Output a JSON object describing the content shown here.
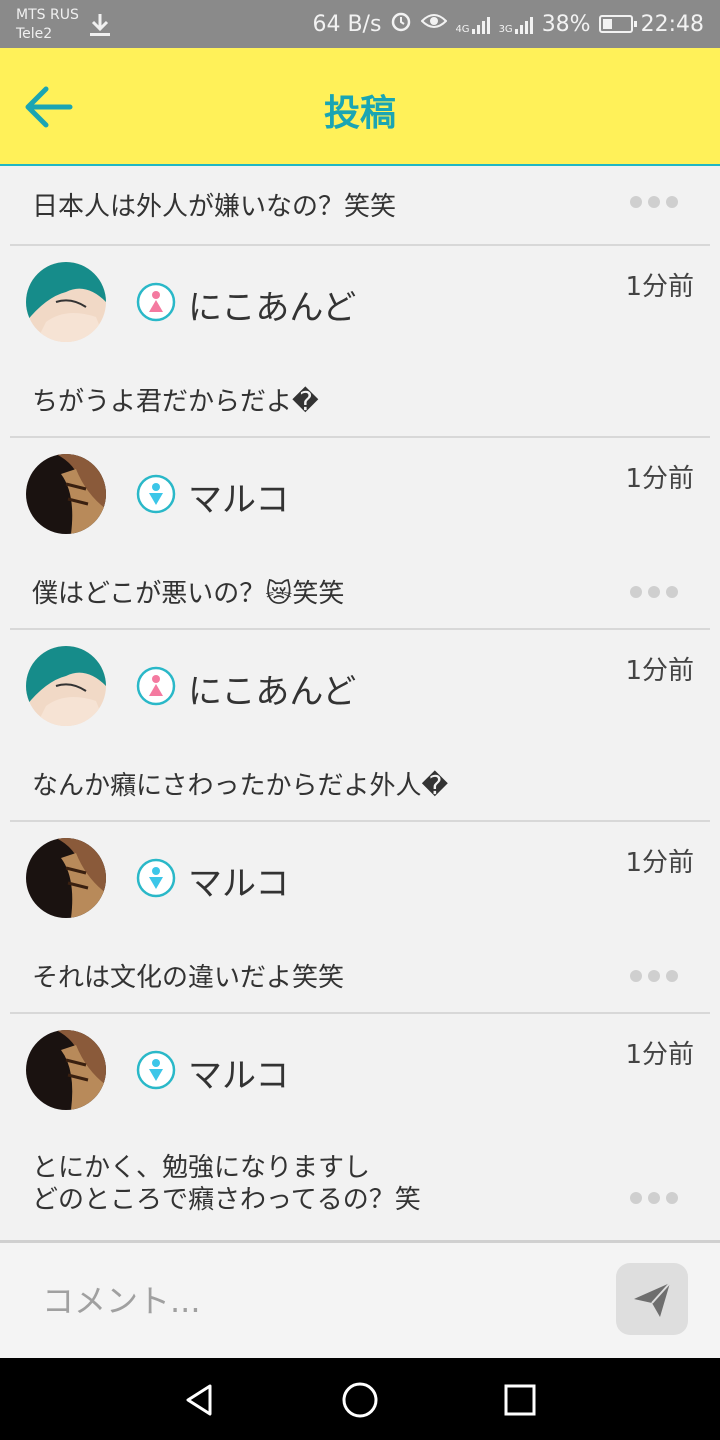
{
  "status_bar": {
    "carrier_primary": "MTS RUS",
    "carrier_secondary": "Tele2",
    "net_speed": "64 B/s",
    "signal_1": "4G",
    "signal_2": "3G",
    "battery_percent": "38%",
    "battery_level": 0.38,
    "time": "22:48",
    "icons": [
      "download-icon",
      "alarm-icon",
      "eye-icon",
      "signal-icon",
      "battery-icon"
    ]
  },
  "header": {
    "title": "投稿",
    "back_icon": "back-arrow-icon",
    "accent_color": "#1aa5b3",
    "background_color": "#fff159"
  },
  "top_post": {
    "text": "日本人は外人が嫌いなの？笑笑"
  },
  "comments": [
    {
      "username": "にこあんど",
      "gender": "female",
      "time": "1分前",
      "text": "ちがうよ君だからだよ�",
      "show_menu": false
    },
    {
      "username": "マルコ",
      "gender": "male",
      "time": "1分前",
      "text": "僕はどこが悪いの？😿笑笑",
      "show_menu": true
    },
    {
      "username": "にこあんど",
      "gender": "female",
      "time": "1分前",
      "text": "なんか癪にさわったからだよ外人�",
      "show_menu": false
    },
    {
      "username": "マルコ",
      "gender": "male",
      "time": "1分前",
      "text": "それは文化の違いだよ笑笑",
      "show_menu": true
    },
    {
      "username": "マルコ",
      "gender": "male",
      "time": "1分前",
      "text_line1": "とにかく、勉強になりますし",
      "text_line2": "どのところで癪さわってるの？笑",
      "show_menu": true
    }
  ],
  "comment_input": {
    "placeholder": "コメント...",
    "send_icon": "send-icon"
  },
  "nav_bar": {
    "icons": [
      "back-triangle-icon",
      "home-circle-icon",
      "recents-square-icon"
    ]
  }
}
